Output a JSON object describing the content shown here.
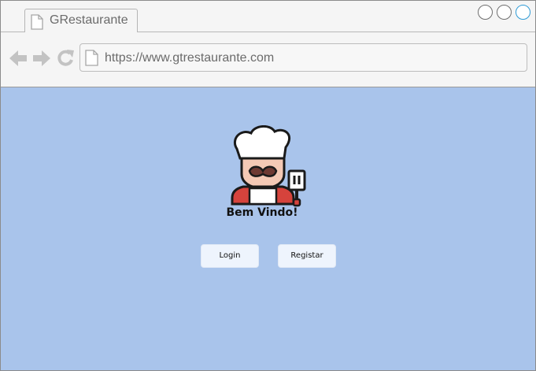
{
  "browser": {
    "tab": {
      "title": "GRestaurante",
      "icon": "page-icon"
    },
    "address_bar": {
      "url": "https://www.gtrestaurante.com",
      "icon": "page-icon"
    },
    "nav_icons": [
      "back-arrow-icon",
      "forward-arrow-icon",
      "refresh-icon"
    ],
    "window_controls": [
      "minimize-control",
      "maximize-control",
      "close-control"
    ]
  },
  "page": {
    "background_color": "#a9c4eb",
    "logo_icon": "chef-icon",
    "welcome_text": "Bem Vindo!",
    "buttons": {
      "login_label": "Login",
      "register_label": "Registar"
    },
    "button_color": "#eef4fd"
  }
}
